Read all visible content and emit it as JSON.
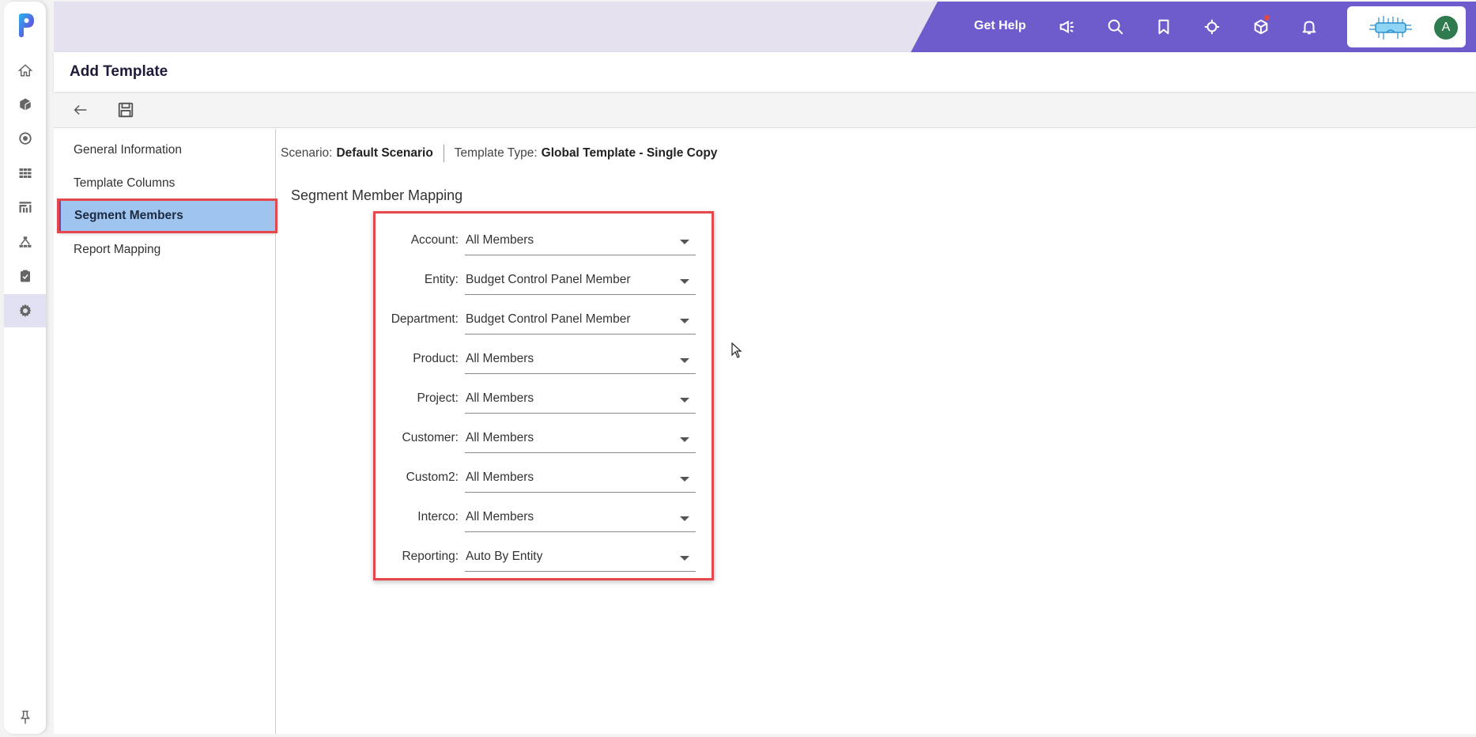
{
  "rail": {
    "logo": "p-logo-icon",
    "items": [
      {
        "name": "home",
        "icon": "home-icon",
        "active": false
      },
      {
        "name": "models",
        "icon": "cube-icon",
        "active": false
      },
      {
        "name": "targets",
        "icon": "target-icon",
        "active": false
      },
      {
        "name": "grid",
        "icon": "grid-icon",
        "active": false
      },
      {
        "name": "reports",
        "icon": "chart-icon",
        "active": false
      },
      {
        "name": "hierarchy",
        "icon": "hierarchy-icon",
        "active": false
      },
      {
        "name": "tasks",
        "icon": "clipboard-check-icon",
        "active": false
      },
      {
        "name": "settings",
        "icon": "gear-icon",
        "active": true
      }
    ],
    "pin": "pin-icon"
  },
  "topbar": {
    "get_help": "Get Help",
    "icons": [
      "megaphone-icon",
      "search-icon",
      "bookmark-icon",
      "crosshair-icon",
      "cube-icon",
      "bell-icon"
    ],
    "avatar_initial": "A",
    "accent": "#6e5ccc"
  },
  "page": {
    "title": "Add Template"
  },
  "toolbar": {
    "back": "back-arrow-icon",
    "save": "save-icon"
  },
  "tabs": [
    {
      "label": "General Information",
      "active": false
    },
    {
      "label": "Template Columns",
      "active": false
    },
    {
      "label": "Segment Members",
      "active": true
    },
    {
      "label": "Report Mapping",
      "active": false
    }
  ],
  "info": {
    "scenario_label": "Scenario:",
    "scenario_value": "Default Scenario",
    "type_label": "Template Type:",
    "type_value": "Global Template - Single Copy"
  },
  "mapping": {
    "title": "Segment Member Mapping",
    "rows": [
      {
        "label": "Account:",
        "value": "All Members"
      },
      {
        "label": "Entity:",
        "value": "Budget Control Panel Member"
      },
      {
        "label": "Department:",
        "value": "Budget Control Panel Member"
      },
      {
        "label": "Product:",
        "value": "All Members"
      },
      {
        "label": "Project:",
        "value": "All Members"
      },
      {
        "label": "Customer:",
        "value": "All Members"
      },
      {
        "label": "Custom2:",
        "value": "All Members"
      },
      {
        "label": "Interco:",
        "value": "All Members"
      },
      {
        "label": "Reporting:",
        "value": "Auto By Entity"
      }
    ]
  }
}
